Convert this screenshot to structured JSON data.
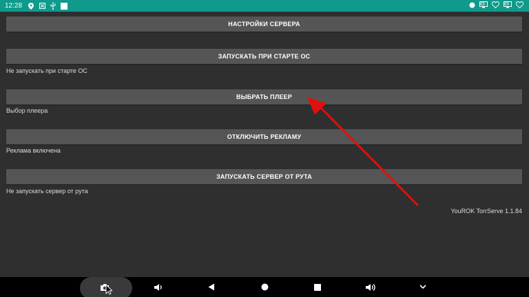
{
  "statusbar": {
    "time": "12:28",
    "left_icons": [
      "location-icon",
      "image-icon",
      "usb-icon",
      "notification-square-icon"
    ],
    "right_icons": [
      "record-dot-icon",
      "cast-icon",
      "heart-icon",
      "cast-icon-2",
      "heart-icon-2"
    ],
    "color": "#0f9a8c"
  },
  "settings": [
    {
      "button": "НАСТРОЙКИ СЕРВЕРА",
      "desc": ""
    },
    {
      "button": "ЗАПУСКАТЬ ПРИ СТАРТЕ ОС",
      "desc": "Не запускать при старте ОС"
    },
    {
      "button": "ВЫБРАТЬ ПЛЕЕР",
      "desc": "Выбор плеера"
    },
    {
      "button": "ОТКЛЮЧИТЬ РЕКЛАМУ",
      "desc": "Реклама включена"
    },
    {
      "button": "ЗАПУСКАТЬ СЕРВЕР ОТ РУТА",
      "desc": "Не запускать сервер от рута"
    }
  ],
  "footer": {
    "version": "YouROK TorrServe 1.1.84"
  },
  "annotation": {
    "arrow_color": "#e01010"
  },
  "navbar": {
    "icons": [
      "camera-icon",
      "volume-down-icon",
      "back-icon",
      "home-icon",
      "recents-icon",
      "volume-up-icon",
      "chevron-down-icon"
    ]
  }
}
